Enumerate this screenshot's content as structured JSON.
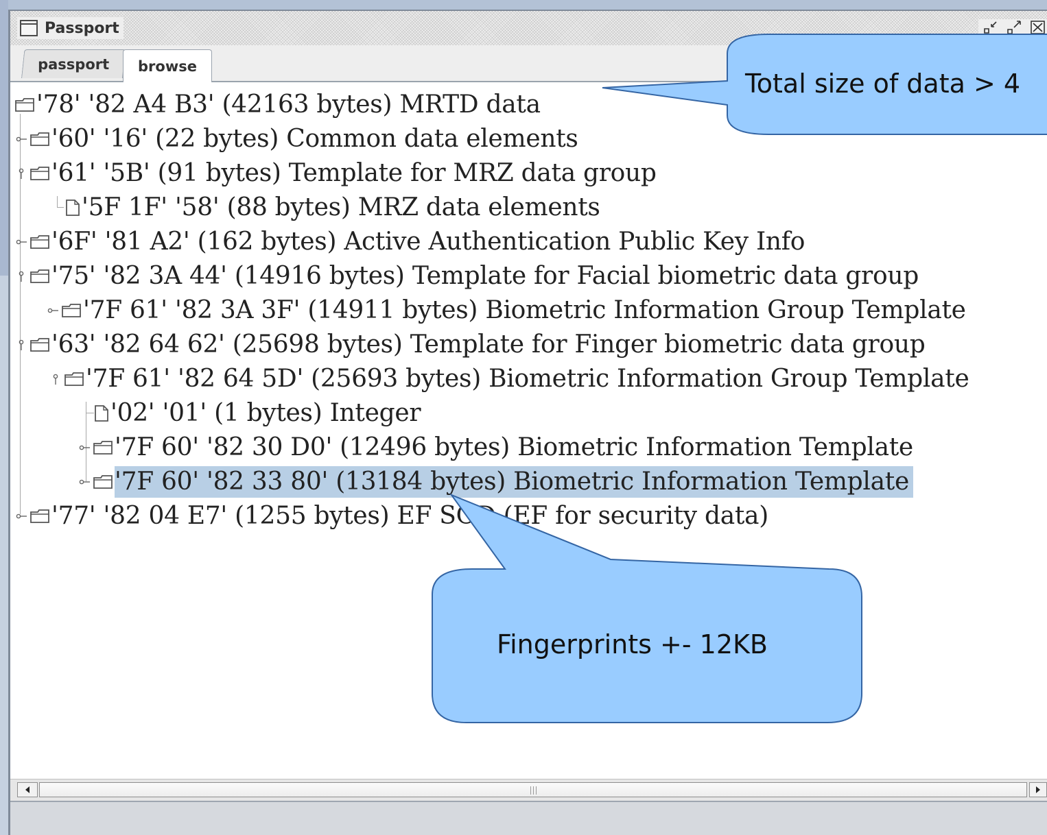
{
  "window": {
    "title": "Passport",
    "icon": "window-icon",
    "buttons": [
      "minimize-icon",
      "maximize-icon",
      "close-icon"
    ]
  },
  "tabs": [
    {
      "label": "passport",
      "selected": false
    },
    {
      "label": "browse",
      "selected": true
    }
  ],
  "tree": {
    "root": {
      "label": "'78' '82 A4 B3' (42163 bytes) MRTD data"
    },
    "nodes": [
      {
        "label": "'60' '16' (22 bytes) Common data elements"
      },
      {
        "label": "'61' '5B' (91 bytes) Template for MRZ data group"
      },
      {
        "label": "'5F 1F' '58' (88 bytes) MRZ data elements"
      },
      {
        "label": "'6F' '81 A2' (162 bytes) Active Authentication Public Key Info"
      },
      {
        "label": "'75' '82 3A 44' (14916 bytes) Template for Facial biometric data group"
      },
      {
        "label": "'7F 61' '82 3A 3F' (14911 bytes) Biometric Information Group Template"
      },
      {
        "label": "'63' '82 64 62' (25698 bytes) Template for Finger biometric data group"
      },
      {
        "label": "'7F 61' '82 64 5D' (25693 bytes) Biometric Information Group Template"
      },
      {
        "label": "'02' '01' (1 bytes) Integer"
      },
      {
        "label": "'7F 60' '82 30 D0' (12496 bytes) Biometric Information Template"
      },
      {
        "label": "'7F 60' '82 33 80' (13184 bytes) Biometric Information Template",
        "selected": true
      },
      {
        "label": "'77' '82 04 E7' (1255 bytes) EF SOD (EF for security data)"
      }
    ]
  },
  "callouts": {
    "total_size": "Total size of data > 4",
    "fingerprints": "Fingerprints +- 12KB"
  },
  "colors": {
    "selection": "#b8cfe5",
    "callout_fill": "#99ccff",
    "callout_stroke": "#3465a4"
  }
}
